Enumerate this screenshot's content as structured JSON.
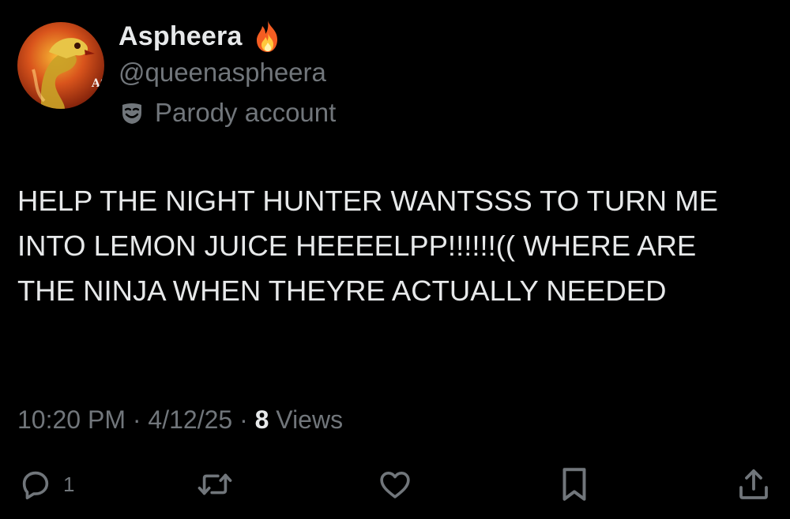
{
  "author": {
    "display_name": "Aspheera",
    "name_emoji_icon": "fire-icon",
    "handle": "@queenaspheera",
    "label_icon": "theater-mask-icon",
    "label": "Parody account",
    "avatar": "snake-character-avatar"
  },
  "tweet": {
    "text": "HELP THE NIGHT HUNTER WANTSSS TO TURN ME INTO LEMON JUICE HEEEELPP!!!!!!(( WHERE ARE THE NINJA WHEN THEYRE ACTUALLY NEEDED",
    "time": "10:20 PM",
    "separator": "·",
    "date": "4/12/25",
    "views_count": "8",
    "views_label": "Views"
  },
  "actions": {
    "reply_icon": "reply-icon",
    "reply_count": "1",
    "retweet_icon": "retweet-icon",
    "like_icon": "heart-icon",
    "bookmark_icon": "bookmark-icon",
    "share_icon": "share-icon"
  },
  "colors": {
    "background": "#000000",
    "primary_text": "#e7e9ea",
    "secondary_text": "#71767b"
  }
}
